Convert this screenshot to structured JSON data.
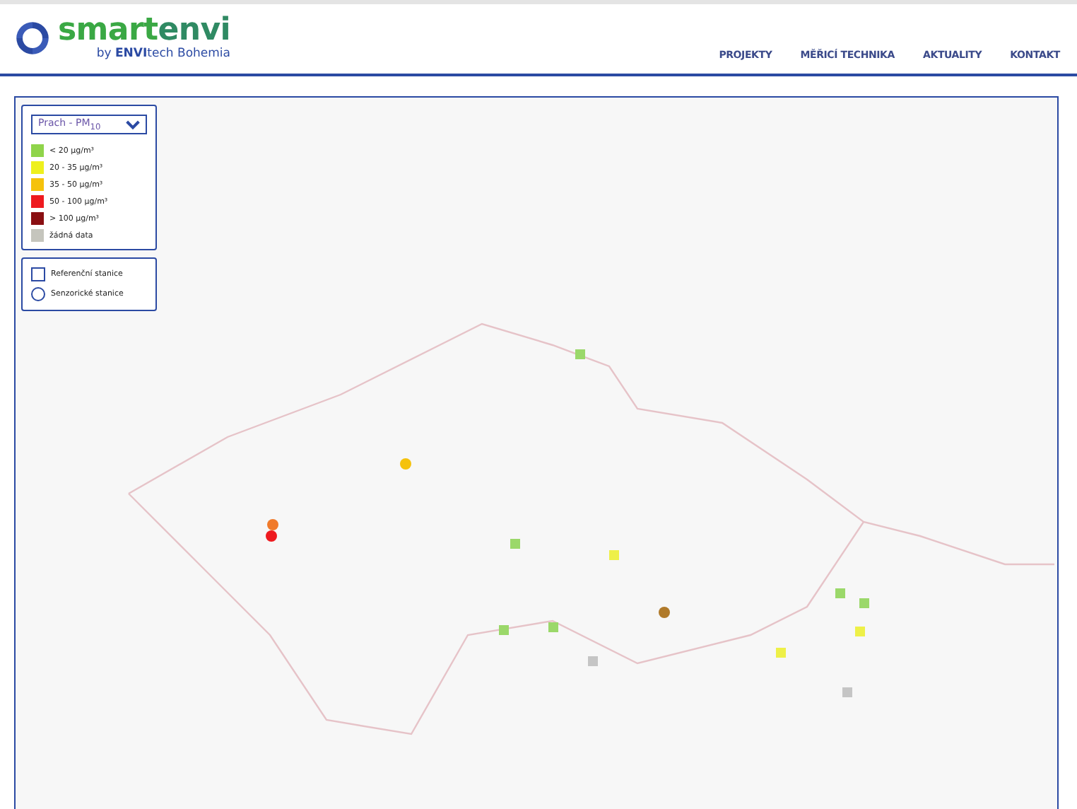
{
  "header": {
    "logo": {
      "parts": [
        "smart",
        "envi"
      ],
      "byline": "by **ENVI**tech Bohemia"
    },
    "nav": [
      {
        "label": "PROJEKTY"
      },
      {
        "label": "MĚŘICÍ TECHNIKA"
      },
      {
        "label": "AKTUALITY"
      },
      {
        "label": "KONTAKT"
      }
    ]
  },
  "map": {
    "pollutant_select": {
      "value": "Prach - PM$_{10}$"
    },
    "legend": [
      {
        "label": "< 20 µg/m³",
        "color": "#8fd44a"
      },
      {
        "label": "20 - 35 µg/m³",
        "color": "#eef01e"
      },
      {
        "label": "35 - 50 µg/m³",
        "color": "#f5c20c"
      },
      {
        "label": "50 - 100 µg/m³",
        "color": "#ee1a1f"
      },
      {
        "label": "> 100 µg/m³",
        "color": "#8a0f12"
      },
      {
        "label": "žádná data",
        "color": "#c5c5bd"
      }
    ],
    "station_types": [
      {
        "kind": "square",
        "label": "Referenční stanice"
      },
      {
        "kind": "circle",
        "label": "Senzorické stanice"
      }
    ],
    "markers": [
      {
        "kind": "square",
        "color": "#9bd86a"
      },
      {
        "kind": "circle",
        "color": "#f5c20c"
      },
      {
        "kind": "circle",
        "color": "#f07a2a"
      },
      {
        "kind": "circle",
        "color": "#ee1a1f"
      },
      {
        "kind": "square",
        "color": "#9bd86a"
      },
      {
        "kind": "square",
        "color": "#eef048"
      },
      {
        "kind": "circle",
        "color": "#b07a2a"
      },
      {
        "kind": "square",
        "color": "#9bd86a"
      },
      {
        "kind": "square",
        "color": "#9bd86a"
      },
      {
        "kind": "square",
        "color": "#c5c5c5"
      },
      {
        "kind": "square",
        "color": "#eef048"
      },
      {
        "kind": "square",
        "color": "#9bd86a"
      },
      {
        "kind": "square",
        "color": "#9bd86a"
      },
      {
        "kind": "square",
        "color": "#eef048"
      },
      {
        "kind": "square",
        "color": "#c5c5c5"
      }
    ]
  }
}
